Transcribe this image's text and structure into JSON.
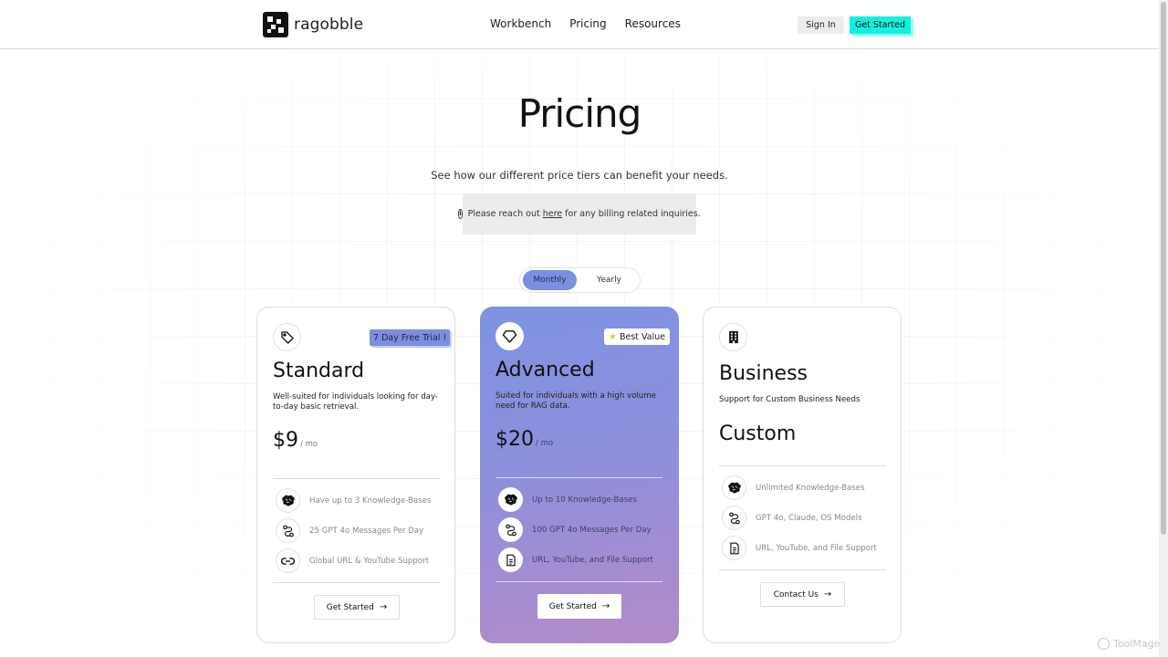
{
  "brand": {
    "name": "ragobble"
  },
  "nav": {
    "items": [
      "Workbench",
      "Pricing",
      "Resources"
    ]
  },
  "header": {
    "sign_in": "Sign In",
    "get_started": "Get Started"
  },
  "hero": {
    "title": "Pricing",
    "subtitle": "See how our different price tiers can benefit your needs.",
    "notice_prefix": "Please reach out ",
    "notice_link": "here",
    "notice_suffix": " for any billing related inquiries."
  },
  "billing_toggle": {
    "monthly": "Monthly",
    "yearly": "Yearly",
    "selected": "Monthly"
  },
  "plans": [
    {
      "badge": "7 Day Free Trial !",
      "name": "Standard",
      "description": "Well-suited for individuals looking for day-to-day basic retrieval.",
      "price": "$9",
      "period": "/ mo",
      "icon": "tag-icon",
      "features": [
        {
          "icon": "brain-icon",
          "text": "Have up to 3 Knowledge-Bases"
        },
        {
          "icon": "route-icon",
          "text": "25 GPT 4o Messages Per Day"
        },
        {
          "icon": "link-icon",
          "text": "Global URL & YouTube Support"
        }
      ],
      "cta": "Get Started"
    },
    {
      "badge": "Best Value",
      "name": "Advanced",
      "description": "Suited for individuals with a high volume need for RAG data.",
      "price": "$20",
      "period": "/ mo",
      "icon": "diamond-icon",
      "features": [
        {
          "icon": "brain-icon",
          "text": "Up to 10 Knowledge-Bases"
        },
        {
          "icon": "route-icon",
          "text": "100 GPT 4o Messages Per Day"
        },
        {
          "icon": "document-icon",
          "text": "URL, YouTube, and File Support"
        }
      ],
      "cta": "Get Started"
    },
    {
      "name": "Business",
      "description": "Support for Custom Business Needs",
      "price": "Custom",
      "icon": "building-icon",
      "features": [
        {
          "icon": "brain-icon",
          "text": "Unlimited Knowledge-Bases"
        },
        {
          "icon": "route-icon",
          "text": "GPT 4o, Claude, OS Models"
        },
        {
          "icon": "document-icon",
          "text": "URL, YouTube, and File Support"
        }
      ],
      "cta": "Contact Us"
    }
  ],
  "watermark": "ToolMage",
  "colors": {
    "accent_cyan": "#12f1e0",
    "accent_blue": "#7b8ee0",
    "advanced_gradient_end": "#b48bc9"
  }
}
